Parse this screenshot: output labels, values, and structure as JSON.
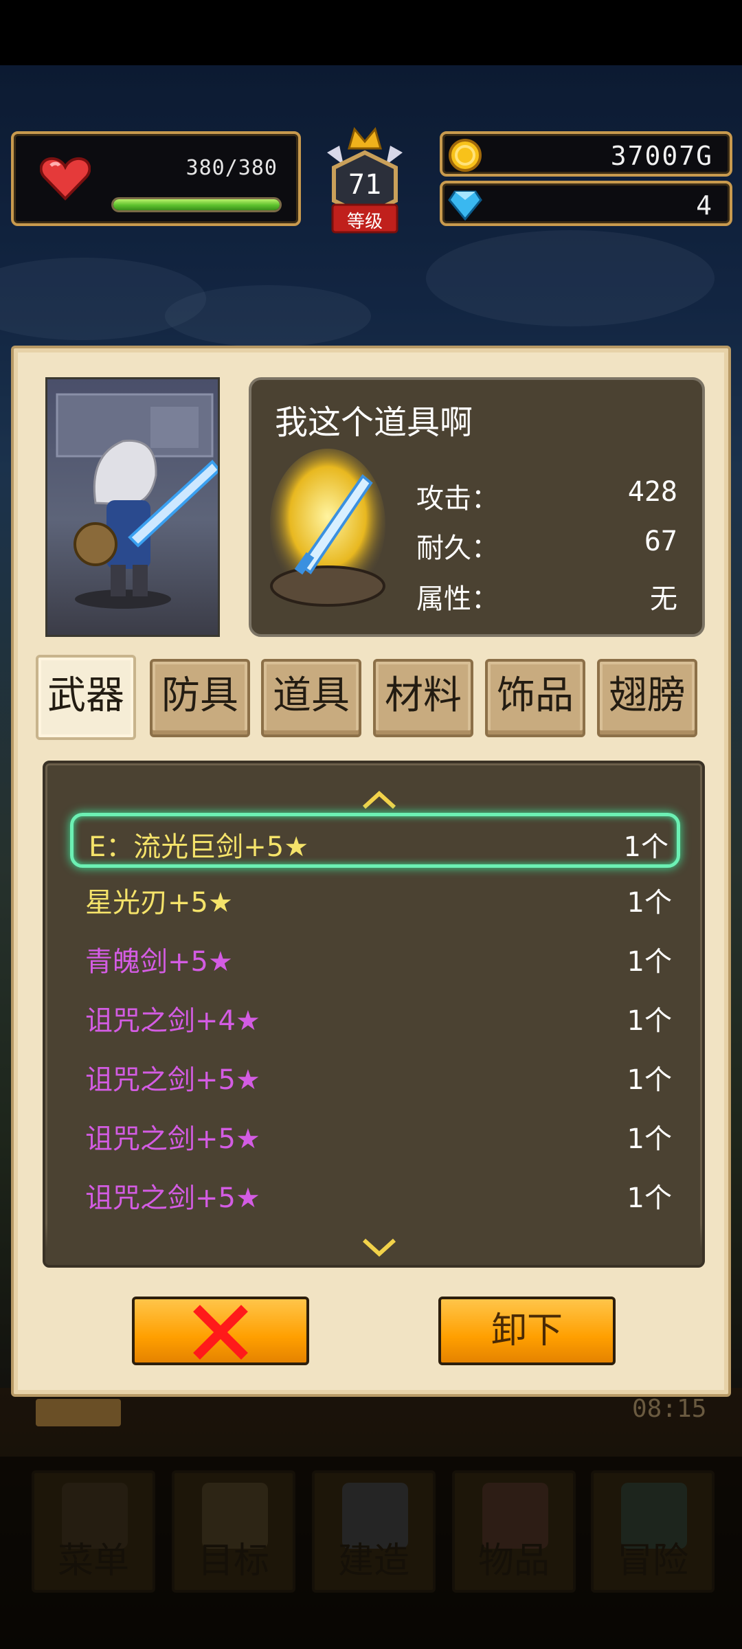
{
  "hud": {
    "hp_text": "380/380",
    "hp_fraction": 1.0,
    "level": "71",
    "level_label": "等级",
    "gold": "37007G",
    "gems": "4"
  },
  "item_info": {
    "title": "我这个道具啊",
    "stats": [
      {
        "label": "攻击：",
        "value": "428"
      },
      {
        "label": "耐久：",
        "value": "67"
      },
      {
        "label": "属性：",
        "value": "无"
      }
    ]
  },
  "tabs": [
    {
      "label": "武器",
      "active": true
    },
    {
      "label": "防具",
      "active": false
    },
    {
      "label": "道具",
      "active": false
    },
    {
      "label": "材料",
      "active": false
    },
    {
      "label": "饰品",
      "active": false
    },
    {
      "label": "翅膀",
      "active": false
    }
  ],
  "list": {
    "items": [
      {
        "name": "E：流光巨剑+5★",
        "qty": "1个",
        "color": "#f5e36a",
        "selected": true
      },
      {
        "name": "星光刃+5★",
        "qty": "1个",
        "color": "#f5e36a",
        "selected": false
      },
      {
        "name": "青魄剑+5★",
        "qty": "1个",
        "color": "#d35ce3",
        "selected": false
      },
      {
        "name": "诅咒之剑+4★",
        "qty": "1个",
        "color": "#d35ce3",
        "selected": false
      },
      {
        "name": "诅咒之剑+5★",
        "qty": "1个",
        "color": "#d35ce3",
        "selected": false
      },
      {
        "name": "诅咒之剑+5★",
        "qty": "1个",
        "color": "#d35ce3",
        "selected": false
      },
      {
        "name": "诅咒之剑+5★",
        "qty": "1个",
        "color": "#d35ce3",
        "selected": false
      }
    ]
  },
  "buttons": {
    "unequip": "卸下"
  },
  "clock": "08:15",
  "nav": [
    {
      "label": "菜单",
      "icon": "menu-grid-icon"
    },
    {
      "label": "目标",
      "icon": "quest-scroll-icon"
    },
    {
      "label": "建造",
      "icon": "castle-icon"
    },
    {
      "label": "物品",
      "icon": "treasure-chest-icon"
    },
    {
      "label": "冒险",
      "icon": "mountain-icon"
    }
  ],
  "colors": {
    "accent_orange": "#ff9f00",
    "selected_glow": "#6cf0b4",
    "gold_text": "#f5e36a",
    "magenta_text": "#d35ce3"
  }
}
